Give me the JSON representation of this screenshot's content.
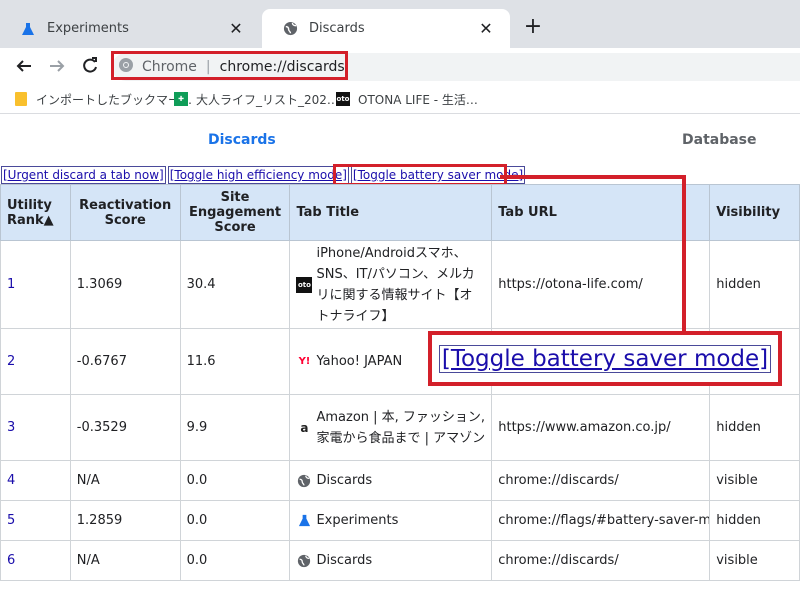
{
  "browser": {
    "tabs": [
      {
        "label": "Experiments",
        "icon": "flask-icon",
        "active": false
      },
      {
        "label": "Discards",
        "icon": "globe-icon",
        "active": true
      }
    ],
    "omnibox": {
      "chip": "Chrome",
      "url": "chrome://discards"
    },
    "bookmarks": [
      {
        "label": "インポートしたブックマー…",
        "icon": "folder-icon"
      },
      {
        "label": "大人ライフ_リスト_202…",
        "icon": "sheets-icon"
      },
      {
        "label": "OTONA LIFE - 生活…",
        "icon": "otona-life-icon"
      }
    ]
  },
  "page": {
    "tabs": {
      "discards": "Discards",
      "database": "Database"
    },
    "actions": {
      "urgent": "[Urgent discard a tab now]",
      "high_efficiency": "[Toggle high efficiency mode]",
      "battery_saver": "[Toggle battery saver mode]"
    },
    "headers": {
      "rank": "Utility Rank▲",
      "reactivation": "Reactivation Score",
      "engagement": "Site Engagement Score",
      "title": "Tab Title",
      "url": "Tab URL",
      "visibility": "Visibility"
    },
    "rows": [
      {
        "rank": "1",
        "reactivation": "1.3069",
        "engagement": "30.4",
        "title": "iPhone/Androidスマホ、SNS、IT/パソコン、メルカリに関する情報サイト【オトナライフ】",
        "url": "https://otona-life.com/",
        "visibility": "hidden",
        "icon": "otona-life-icon"
      },
      {
        "rank": "2",
        "reactivation": "-0.6767",
        "engagement": "11.6",
        "title": "Yahoo! JAPAN",
        "url": "",
        "visibility": "",
        "icon": "yahoo-icon"
      },
      {
        "rank": "3",
        "reactivation": "-0.3529",
        "engagement": "9.9",
        "title": "Amazon | 本, ファッション, 家電から食品まで | アマゾン",
        "url": "https://www.amazon.co.jp/",
        "visibility": "hidden",
        "icon": "amazon-icon"
      },
      {
        "rank": "4",
        "reactivation": "N/A",
        "engagement": "0.0",
        "title": "Discards",
        "url": "chrome://discards/",
        "visibility": "visible",
        "icon": "globe-icon"
      },
      {
        "rank": "5",
        "reactivation": "1.2859",
        "engagement": "0.0",
        "title": "Experiments",
        "url": "chrome://flags/#battery-saver-mod",
        "visibility": "hidden",
        "icon": "flask-icon"
      },
      {
        "rank": "6",
        "reactivation": "N/A",
        "engagement": "0.0",
        "title": "Discards",
        "url": "chrome://discards/",
        "visibility": "visible",
        "icon": "globe-icon"
      }
    ],
    "callout": "[Toggle battery saver mode]"
  },
  "colors": {
    "highlight": "#d3202a",
    "link": "#1a0dab",
    "header_bg": "#d5e5f7",
    "accent": "#1a73e8"
  }
}
